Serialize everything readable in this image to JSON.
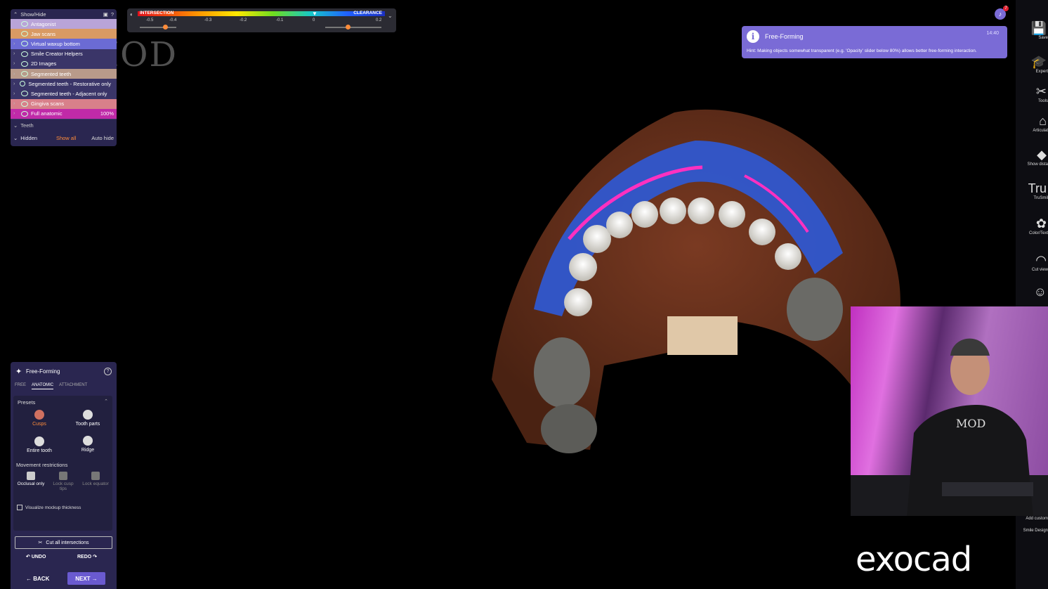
{
  "showhide": {
    "title": "Show/Hide",
    "items": [
      {
        "label": "Antagonist",
        "color": "#b9a4d8",
        "chev": "",
        "pct": ""
      },
      {
        "label": "Jaw scans",
        "color": "#d99a63",
        "chev": "",
        "pct": ""
      },
      {
        "label": "Virtual waxup bottom",
        "color": "#6b6bd4",
        "chev": "›",
        "pct": ""
      },
      {
        "label": "Smile Creator Helpers",
        "color": "#3a3568",
        "chev": "›",
        "pct": ""
      },
      {
        "label": "2D Images",
        "color": "#3a3568",
        "chev": "›",
        "pct": ""
      },
      {
        "label": "Segmented teeth",
        "color": "#b89a8a",
        "chev": "›",
        "pct": ""
      },
      {
        "label": "Segmented teeth - Restorative only",
        "color": "#3a3568",
        "chev": "›",
        "pct": ""
      },
      {
        "label": "Segmented teeth - Adjacent only",
        "color": "#3a3568",
        "chev": "›",
        "pct": ""
      },
      {
        "label": "Gingiva scans",
        "color": "#d8808a",
        "chev": "›",
        "pct": ""
      },
      {
        "label": "Full anatomic",
        "color": "#c02aa8",
        "chev": "›",
        "pct": "100%"
      }
    ],
    "teeth_label": "Teeth",
    "hidden_label": "Hidden",
    "show_all": "Show all",
    "auto_hide": "Auto hide"
  },
  "colorbar": {
    "left_label": "INTERSECTION",
    "right_label": "CLEARANCE",
    "ticks": [
      "-0.5",
      "-0.4",
      "-0.3",
      "-0.2",
      "-0.1",
      "0",
      "0.2"
    ]
  },
  "notification": {
    "title": "Free-Forming",
    "time": "14:40",
    "hint": "Hint: Making objects somewhat transparent (e.g. 'Opacity' slider below 80%) allows better free-forming interaction.",
    "badge": "7"
  },
  "watermark": "MOD",
  "brand": "exocad",
  "right_toolbar": [
    {
      "label": "Save",
      "glyph": "💾"
    },
    {
      "label": "Expert",
      "glyph": "🎓"
    },
    {
      "label": "Tools",
      "glyph": "✂"
    },
    {
      "label": "Articulat",
      "glyph": "⌂"
    },
    {
      "label": "Show dista",
      "glyph": "◆"
    },
    {
      "label": "TruSmil",
      "glyph": "Tru"
    },
    {
      "label": "Color/Text",
      "glyph": "✿"
    },
    {
      "label": "Cut view",
      "glyph": "◠"
    },
    {
      "label": "",
      "glyph": "☺"
    },
    {
      "label": "Add custom",
      "glyph": ""
    },
    {
      "label": "Smile Design",
      "glyph": ""
    }
  ],
  "freeforming": {
    "title": "Free-Forming",
    "tabs": [
      "FREE",
      "ANATOMIC",
      "ATTACHMENT"
    ],
    "active_tab": "ANATOMIC",
    "presets_label": "Presets",
    "presets": [
      "Cusps",
      "Tooth parts",
      "Entire tooth",
      "Ridge"
    ],
    "movement_label": "Movement restrictions",
    "movements": [
      "Occlusal only",
      "Lock cusp tips",
      "Lock equator"
    ],
    "visualize": "Visualize mockup thickness",
    "cut_all": "Cut all intersections",
    "undo": "UNDO",
    "redo": "REDO",
    "back": "BACK",
    "next": "NEXT"
  },
  "colors": {
    "accent": "#7a6bd6",
    "panel": "#2a2650",
    "highlight": "#ff8c3a"
  }
}
